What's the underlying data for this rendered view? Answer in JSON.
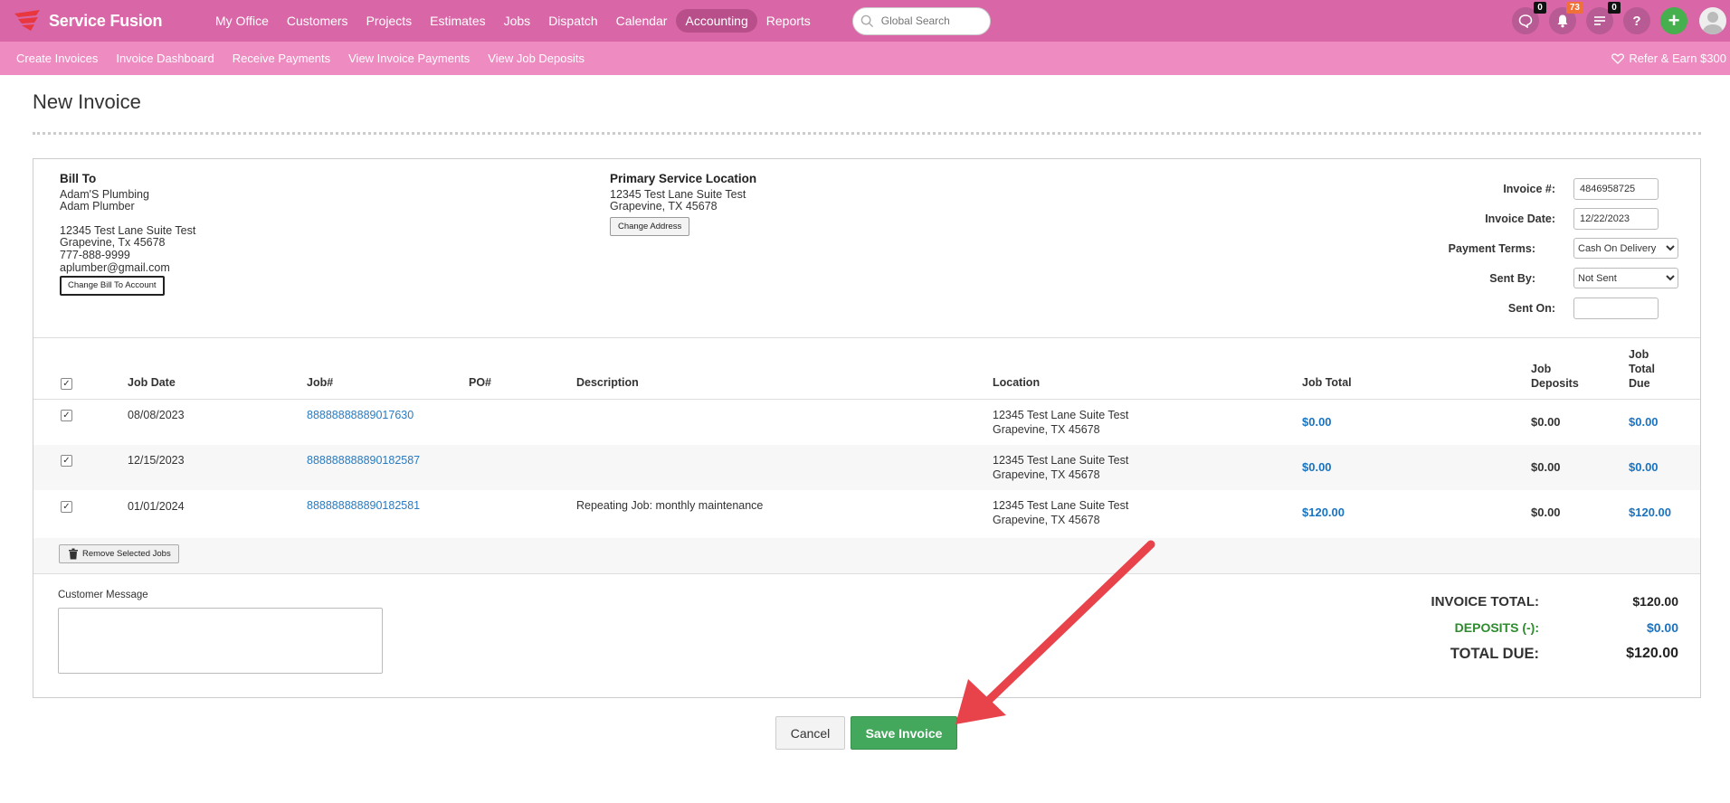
{
  "brand": {
    "name": "Service Fusion"
  },
  "nav": {
    "items": [
      "My Office",
      "Customers",
      "Projects",
      "Estimates",
      "Jobs",
      "Dispatch",
      "Calendar",
      "Accounting",
      "Reports"
    ],
    "active": "Accounting"
  },
  "search": {
    "placeholder": "Global Search"
  },
  "header_icons": {
    "chat_count": "0",
    "notifications_count": "73",
    "tasks_count": "0",
    "help": "?",
    "add": "+"
  },
  "subnav": {
    "items": [
      "Create Invoices",
      "Invoice Dashboard",
      "Receive Payments",
      "View Invoice Payments",
      "View Job Deposits"
    ],
    "refer": "Refer & Earn $300"
  },
  "page": {
    "title": "New Invoice"
  },
  "bill_to": {
    "heading": "Bill To",
    "company": "Adam'S Plumbing",
    "contact": "Adam Plumber",
    "street": "12345 Test Lane Suite Test",
    "city": "Grapevine, Tx 45678",
    "phone": "777-888-9999",
    "email": "aplumber@gmail.com",
    "change_button": "Change Bill To Account"
  },
  "service_location": {
    "heading": "Primary Service Location",
    "street": "12345 Test Lane Suite Test",
    "city": "Grapevine, TX 45678",
    "change_button": "Change Address"
  },
  "invoice_fields": {
    "number_label": "Invoice #:",
    "number_value": "4846958725",
    "date_label": "Invoice Date:",
    "date_value": "12/22/2023",
    "terms_label": "Payment Terms:",
    "terms_value": "Cash On Delivery",
    "sent_by_label": "Sent By:",
    "sent_by_value": "Not Sent",
    "sent_on_label": "Sent On:",
    "sent_on_value": ""
  },
  "table": {
    "headers": {
      "job_date": "Job Date",
      "job_num": "Job#",
      "po": "PO#",
      "description": "Description",
      "location": "Location",
      "job_total": "Job Total",
      "job_deposits_1": "Job",
      "job_deposits_2": "Deposits",
      "due_1": "Job",
      "due_2": "Total",
      "due_3": "Due"
    },
    "rows": [
      {
        "date": "08/08/2023",
        "job": "88888888889017630",
        "po": "",
        "description": "",
        "loc1": "12345 Test Lane Suite Test",
        "loc2": "Grapevine, TX 45678",
        "total": "$0.00",
        "deposits": "$0.00",
        "due": "$0.00"
      },
      {
        "date": "12/15/2023",
        "job": "888888888890182587",
        "po": "",
        "description": "",
        "loc1": "12345 Test Lane Suite Test",
        "loc2": "Grapevine, TX 45678",
        "total": "$0.00",
        "deposits": "$0.00",
        "due": "$0.00"
      },
      {
        "date": "01/01/2024",
        "job": "888888888890182581",
        "po": "",
        "description": "Repeating Job: monthly maintenance",
        "loc1": "12345 Test Lane Suite Test",
        "loc2": "Grapevine, TX 45678",
        "total": "$120.00",
        "deposits": "$0.00",
        "due": "$120.00"
      }
    ],
    "remove_button": "Remove Selected Jobs"
  },
  "customer_message": {
    "label": "Customer Message",
    "value": ""
  },
  "totals": {
    "invoice_total_label": "INVOICE TOTAL:",
    "invoice_total_value": "$120.00",
    "deposits_label": "DEPOSITS (-):",
    "deposits_value": "$0.00",
    "total_due_label": "TOTAL DUE:",
    "total_due_value": "$120.00"
  },
  "actions": {
    "cancel": "Cancel",
    "save": "Save Invoice"
  },
  "colors": {
    "topbar": "#d966a6",
    "subbar": "#ee8bc1",
    "save": "#44a85c",
    "arrow": "#e8434b",
    "link": "#2a7abf",
    "deposits": "#2e8b2e"
  }
}
